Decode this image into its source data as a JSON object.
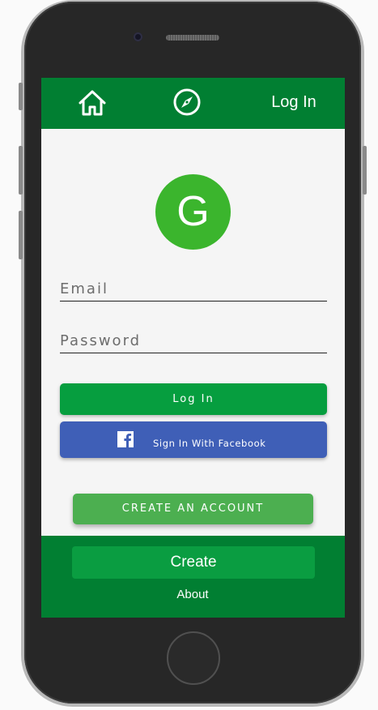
{
  "nav": {
    "home_icon": "home-icon",
    "compass_icon": "compass-icon",
    "login_label": "Log In"
  },
  "avatar": {
    "letter": "G"
  },
  "form": {
    "email_placeholder": "Email",
    "email_value": "",
    "password_placeholder": "Password",
    "password_value": ""
  },
  "buttons": {
    "login_label": "Log In",
    "facebook_label": "Sign In With Facebook",
    "facebook_icon": "facebook-icon",
    "create_account_label": "CREATE AN ACCOUNT"
  },
  "footer": {
    "create_label": "Create",
    "about_label": "About"
  },
  "colors": {
    "brand_green": "#017f32",
    "button_green": "#069e3f",
    "avatar_green": "#3bb52d",
    "facebook_blue": "#3f5fb7",
    "create_account_green": "#4caf50",
    "screen_bg": "#f5f5f5"
  }
}
